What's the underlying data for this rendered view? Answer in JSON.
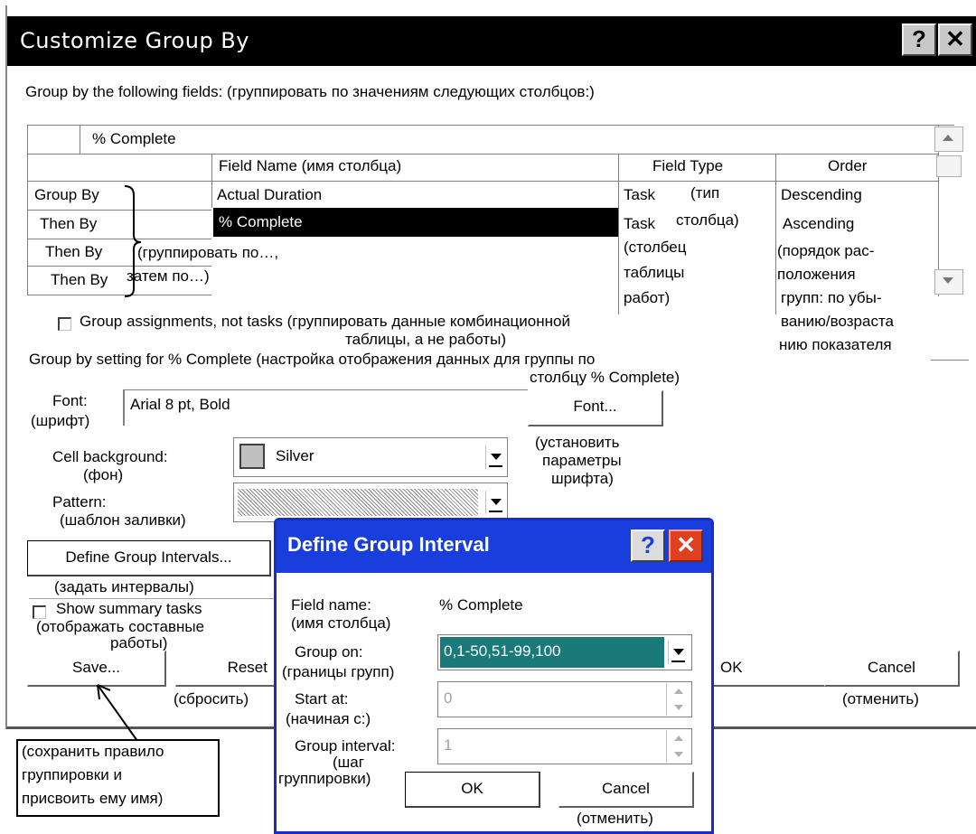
{
  "window": {
    "title": "Customize Group By",
    "help_label": "?",
    "close_label": "✕"
  },
  "group_by_label": "Group by the following fields: (группировать по значениям следующих столбцов:)",
  "grid": {
    "header_cell": "% Complete",
    "columns": [
      "Field Name (имя столбца)",
      "Field Type",
      "Order"
    ],
    "rows": [
      {
        "label": "Group By",
        "field": "Actual Duration",
        "type": "Task",
        "order": "Descending"
      },
      {
        "label": "Then By",
        "field": "% Complete",
        "type": "Task",
        "order": "Ascending"
      },
      {
        "label": "Then By",
        "field": "",
        "type": "",
        "order": ""
      },
      {
        "label": "Then By",
        "field": "",
        "type": "",
        "order": ""
      }
    ],
    "note_rows": "(группировать по…,",
    "note_rows2": "затем по…)",
    "note_type1": "(тип",
    "note_type2": "столбца)",
    "note_type3": "(столбец",
    "note_type4": "таблицы",
    "note_type5": "работ)",
    "note_order1": "(порядок рас-",
    "note_order2": "положения",
    "note_order3": "групп: по убы-",
    "note_order4": "ванию/возраста",
    "note_order5": "нию показателя"
  },
  "assignments": {
    "label": "Group assignments, not tasks (группировать данные комбинационной",
    "label2": "таблицы, а не работы)",
    "checked": false
  },
  "setting_label": "Group by setting for % Complete (настройка отображения данных для группы по",
  "setting_label2": "столбцу % Complete)",
  "font": {
    "label": "Font:",
    "label_ru": "(шрифт)",
    "value": "Arial 8 pt, Bold",
    "button": "Font...",
    "note1": "(установить",
    "note2": "параметры",
    "note3": "шрифта)"
  },
  "cell_background": {
    "label": "Cell background:",
    "label_ru": "(фон)",
    "value": "Silver",
    "swatch_color": "#c0c0c0"
  },
  "pattern": {
    "label": "Pattern:",
    "label_ru": "(шаблон заливки)"
  },
  "define_intervals": {
    "button": "Define Group Intervals...",
    "note": "(задать интервалы)"
  },
  "summary": {
    "label": "Show summary tasks",
    "note1": "(отображать составные",
    "note2": "работы)",
    "checked": false
  },
  "buttons": {
    "save": "Save...",
    "reset": "Reset",
    "reset_note": "(сбросить)",
    "ok": "OK",
    "cancel": "Cancel",
    "cancel_note": "(отменить)"
  },
  "callout": {
    "line1": "(сохранить правило",
    "line2": "группировки и",
    "line3": "присвоить ему имя)"
  },
  "interval_dialog": {
    "title": "Define Group Interval",
    "help_label": "?",
    "close_label": "✕",
    "field_name_label": "Field name:",
    "field_name_label_ru": "(имя столбца)",
    "field_name_value": "% Complete",
    "group_on_label": "Group on:",
    "group_on_label_ru": "(границы групп)",
    "group_on_value": "0,1-50,51-99,100",
    "start_at_label": "Start at:",
    "start_at_label_ru": "(начиная с:)",
    "start_at_value": "0",
    "interval_label": "Group interval:",
    "interval_label_ru1": "(шаг",
    "interval_label_ru2": "группировки)",
    "interval_value": "1",
    "ok": "OK",
    "cancel": "Cancel",
    "cancel_note": "(отменить)"
  }
}
